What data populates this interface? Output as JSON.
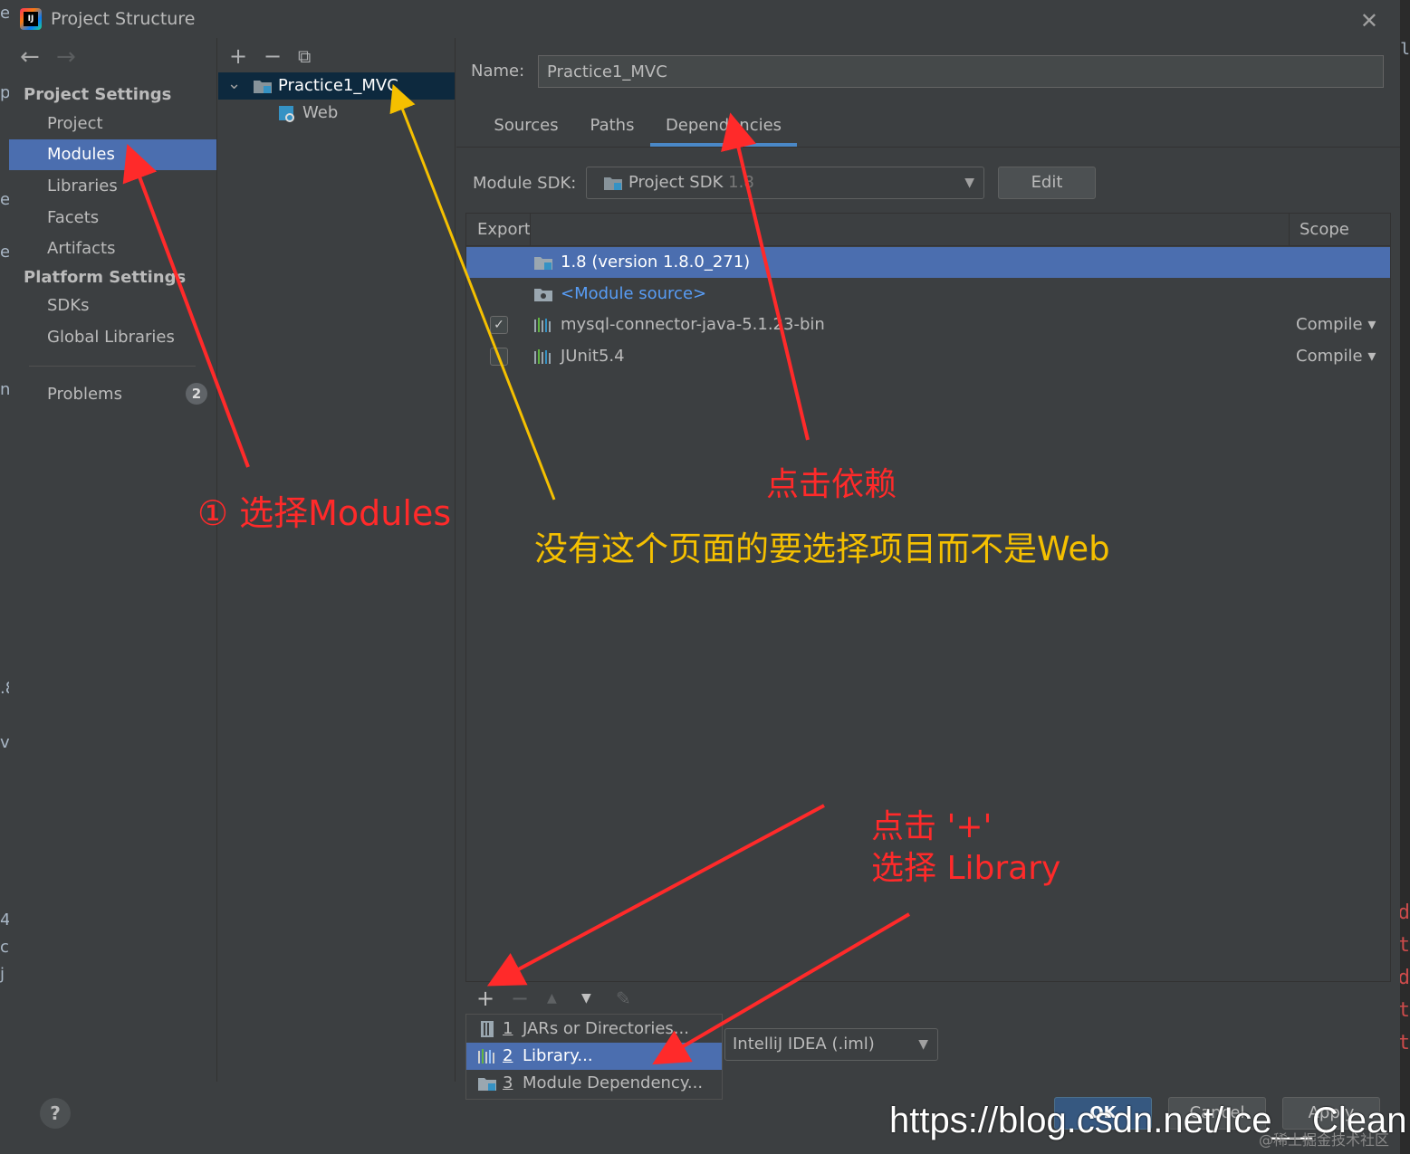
{
  "window": {
    "title": "Project Structure",
    "close_glyph": "✕"
  },
  "background": {
    "left_fragments": [
      "ec",
      "p",
      "e",
      "eli",
      "n",
      ".8",
      "va",
      "4",
      "ce",
      "j"
    ],
    "right_fragments": [
      "nl",
      "d",
      "t",
      "d",
      "t",
      "t"
    ]
  },
  "sidebar": {
    "back_glyph": "←",
    "forward_glyph": "→",
    "project_settings_header": "Project Settings",
    "project_items": [
      {
        "label": "Project",
        "selected": false
      },
      {
        "label": "Modules",
        "selected": true
      },
      {
        "label": "Libraries",
        "selected": false
      },
      {
        "label": "Facets",
        "selected": false
      },
      {
        "label": "Artifacts",
        "selected": false
      }
    ],
    "platform_settings_header": "Platform Settings",
    "platform_items": [
      {
        "label": "SDKs"
      },
      {
        "label": "Global Libraries"
      }
    ],
    "problems": {
      "label": "Problems",
      "count": "2"
    }
  },
  "tree": {
    "toolbar": {
      "add": "+",
      "remove": "−",
      "copy": "⧉"
    },
    "expand_glyph": "⌄",
    "module": "Practice1_MVC",
    "facet": "Web"
  },
  "module": {
    "name_label": "Name:",
    "name_value": "Practice1_MVC",
    "tabs": [
      {
        "label": "Sources",
        "active": false
      },
      {
        "label": "Paths",
        "active": false
      },
      {
        "label": "Dependencies",
        "active": true
      }
    ],
    "sdk_label": "Module SDK:",
    "sdk_value": "Project SDK",
    "sdk_version": "1.8",
    "caret": "▼",
    "edit_label": "Edit",
    "table": {
      "col_export": "Export",
      "col_scope": "Scope",
      "rows": [
        {
          "name": "1.8 (version 1.8.0_271)",
          "icon": "jdk-folder-icon",
          "scope": "",
          "checkbox": null,
          "selected": true
        },
        {
          "name": "<Module source>",
          "icon": "folder-icon",
          "scope": "",
          "checkbox": null,
          "selected": false
        },
        {
          "name": "mysql-connector-java-5.1.23-bin",
          "icon": "library-icon",
          "scope": "Compile ▾",
          "checkbox": true,
          "selected": false
        },
        {
          "name": "JUnit5.4",
          "icon": "library-icon",
          "scope": "Compile ▾",
          "checkbox": false,
          "selected": false
        }
      ]
    },
    "toolbar": {
      "add": "+",
      "remove": "−",
      "up": "▲",
      "down": "▼",
      "edit": "✎"
    },
    "format_value": "IntelliJ IDEA (.iml)",
    "add_menu": [
      {
        "num": "1",
        "label": "JARs or Directories...",
        "icon": "jar-icon",
        "selected": false
      },
      {
        "num": "2",
        "label": "Library...",
        "icon": "library-icon",
        "selected": true
      },
      {
        "num": "3",
        "label": "Module Dependency...",
        "icon": "module-folder-icon",
        "selected": false
      }
    ]
  },
  "footer": {
    "help": "?",
    "ok": "OK",
    "cancel": "Cancel",
    "apply": "Apply"
  },
  "annotations": {
    "select_modules": "① 选择Modules",
    "click_dependencies": "点击依赖",
    "choose_project_not_web": "没有这个页面的要选择项目而不是Web",
    "click_plus": "点击 '+'",
    "select_library": "选择 Library"
  },
  "watermark": {
    "url": "https://blog.csdn.net/Ice__Clean",
    "site": "@稀土掘金技术社区"
  },
  "colors": {
    "selection": "#4b6eaf",
    "tree_selection": "#0d293e",
    "annotation_red": "#ff2a2a",
    "annotation_yellow": "#f5c000",
    "link_blue": "#589df6"
  }
}
